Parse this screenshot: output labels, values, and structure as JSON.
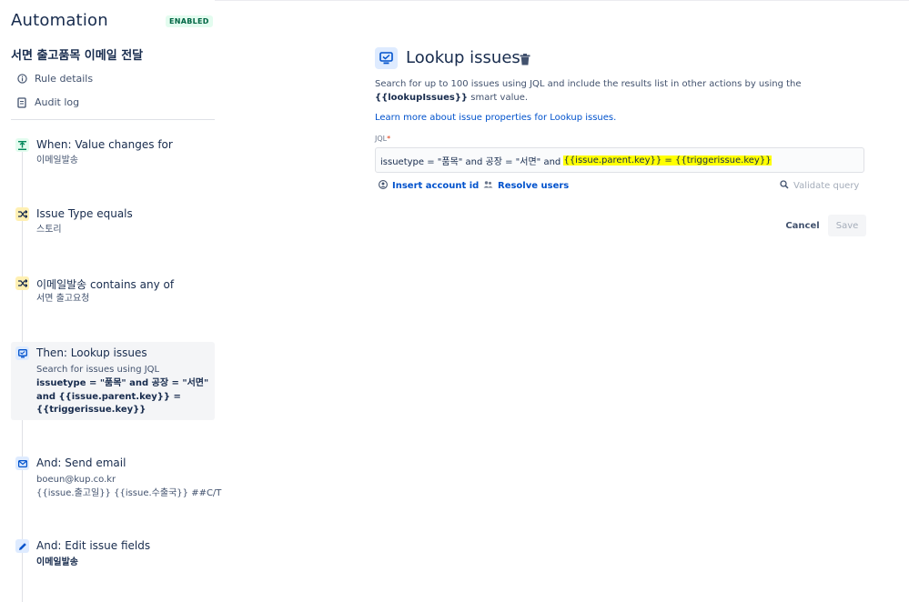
{
  "app": {
    "title": "Automation",
    "status_badge": "ENABLED"
  },
  "rule": {
    "name": "서면 출고품목 이메일 전달"
  },
  "sidebar": {
    "links": [
      {
        "label": "Rule details",
        "icon": "info-icon"
      },
      {
        "label": "Audit log",
        "icon": "document-icon"
      }
    ],
    "steps": [
      {
        "title": "When: Value changes for",
        "lines": [
          "이메일발송"
        ],
        "icon": "trigger-icon",
        "color": "#e3fcef"
      },
      {
        "title": "Issue Type equals",
        "lines": [
          "스토리"
        ],
        "icon": "condition-icon",
        "color": "#fff0b3"
      },
      {
        "title": "이메일발송 contains any of",
        "lines": [
          "서면 출고요청"
        ],
        "icon": "condition-icon",
        "color": "#fff0b3"
      },
      {
        "title": "Then: Lookup issues",
        "sub": "Search for issues using JQL",
        "jql_lines": [
          "issuetype = \"품목\" and 공장 = \"서면\"",
          "and {{issue.parent.key}} =",
          "{{triggerissue.key}}"
        ],
        "icon": "lookup-icon",
        "color": "#deebff",
        "selected": true
      },
      {
        "title": "And: Send email",
        "lines": [
          "boeun@kup.co.kr",
          "{{issue.출고일}} {{issue.수출국}} ##C/T"
        ],
        "icon": "email-icon",
        "color": "#deebff"
      },
      {
        "title": "And: Edit issue fields",
        "bold_line": "이메일발송",
        "icon": "pencil-icon",
        "color": "#deebff"
      }
    ]
  },
  "main": {
    "title": "Lookup issues",
    "desc_before": "Search for up to 100 issues using JQL and include the results list in other actions by using the ",
    "desc_bold": "{{lookupIssues}}",
    "desc_after": " smart value.",
    "learn_link": "Learn more about issue properties for Lookup issues.",
    "jql_label": "JQL",
    "jql_required": "*",
    "jql_plain": "issuetype = \"품목\" and 공장 = \"서면\" and ",
    "jql_highlight": "{{issue.parent.key}} = {{triggerissue.key}}",
    "insert_account": "Insert account id",
    "resolve_users": "Resolve users",
    "validate": "Validate query",
    "cancel": "Cancel",
    "save": "Save"
  }
}
